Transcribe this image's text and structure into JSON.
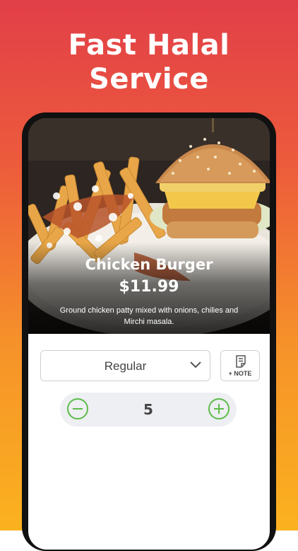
{
  "headline": {
    "line1": "Fast Halal",
    "line2": "Service"
  },
  "item": {
    "name": "Chicken Burger",
    "price": "$11.99",
    "description": "Ground chicken patty mixed with onions, chilies and Mirchi masala.",
    "image": "burger-and-fries-photo"
  },
  "options": {
    "variant": "Regular",
    "note_label": "+ NOTE",
    "quantity": "5"
  },
  "icons": [
    "chevron-down-icon",
    "note-icon",
    "minus-icon",
    "plus-icon"
  ],
  "colors": {
    "accent_green": "#5cbb4a",
    "gradient_top": "#e23f48",
    "gradient_bottom": "#fbb21f"
  }
}
